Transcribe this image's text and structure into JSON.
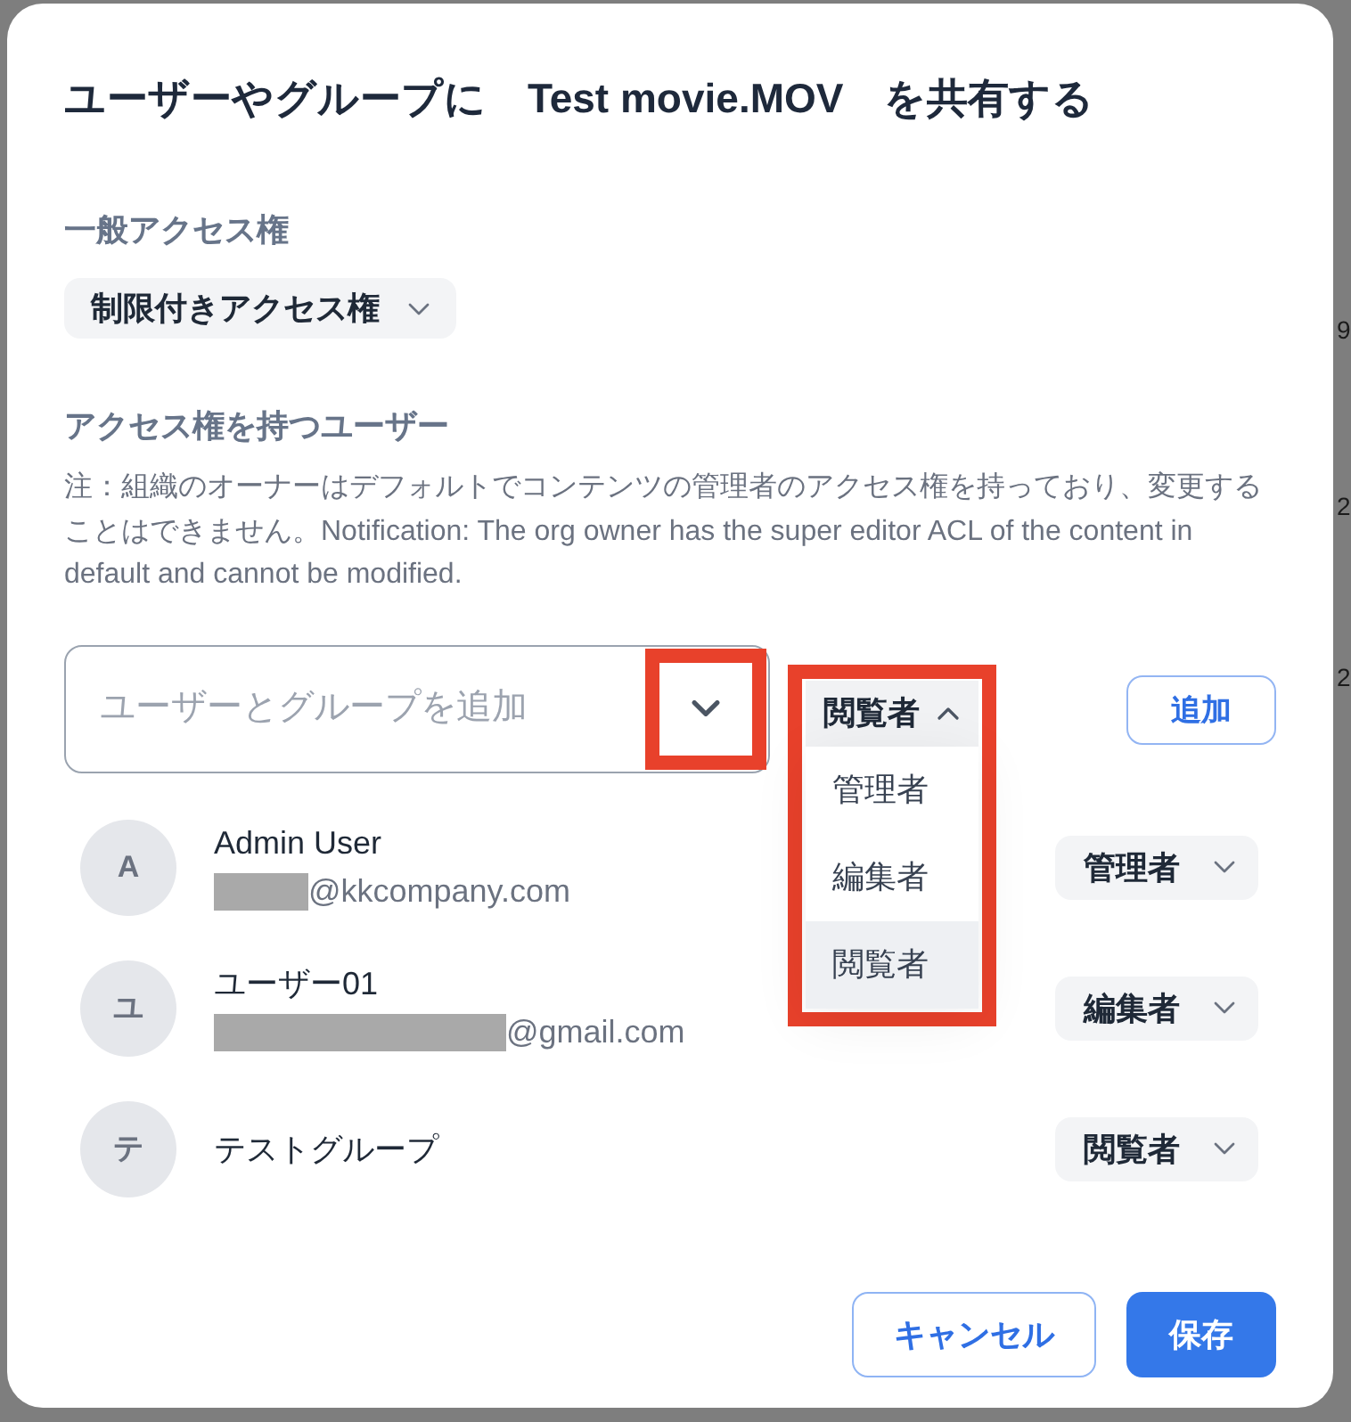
{
  "backdrop": {
    "edge_texts": [
      "9",
      "2",
      "2"
    ]
  },
  "dialog": {
    "title": "ユーザーやグループに　Test movie.MOV　を共有する",
    "general_access": {
      "label": "一般アクセス権",
      "value": "制限付きアクセス権"
    },
    "members_section": {
      "label": "アクセス権を持つユーザー",
      "note": "注：組織のオーナーはデフォルトでコンテンツの管理者のアクセス権を持っており、変更することはできません。Notification: The org owner has the super editor ACL of the content in default and cannot be modified."
    },
    "add_field": {
      "placeholder": "ユーザーとグループを追加",
      "highlighted": true
    },
    "role_select": {
      "value": "閲覧者",
      "expanded": true,
      "highlighted": true,
      "options": [
        {
          "label": "管理者",
          "selected": false
        },
        {
          "label": "編集者",
          "selected": false
        },
        {
          "label": "閲覧者",
          "selected": true
        }
      ]
    },
    "add_button": "追加",
    "members": [
      {
        "initial": "A",
        "name": "Admin User",
        "email": "@kkcompany.com",
        "redacted": true,
        "role": "管理者"
      },
      {
        "initial": "ユ",
        "name": "ユーザー01",
        "email": "@gmail.com",
        "redacted": true,
        "role": "編集者"
      },
      {
        "initial": "テ",
        "name": "テストグループ",
        "role": "閲覧者"
      }
    ],
    "buttons": [
      {
        "label": "キャンセル",
        "kind": "secondary"
      },
      {
        "label": "保存",
        "kind": "primary"
      }
    ]
  }
}
